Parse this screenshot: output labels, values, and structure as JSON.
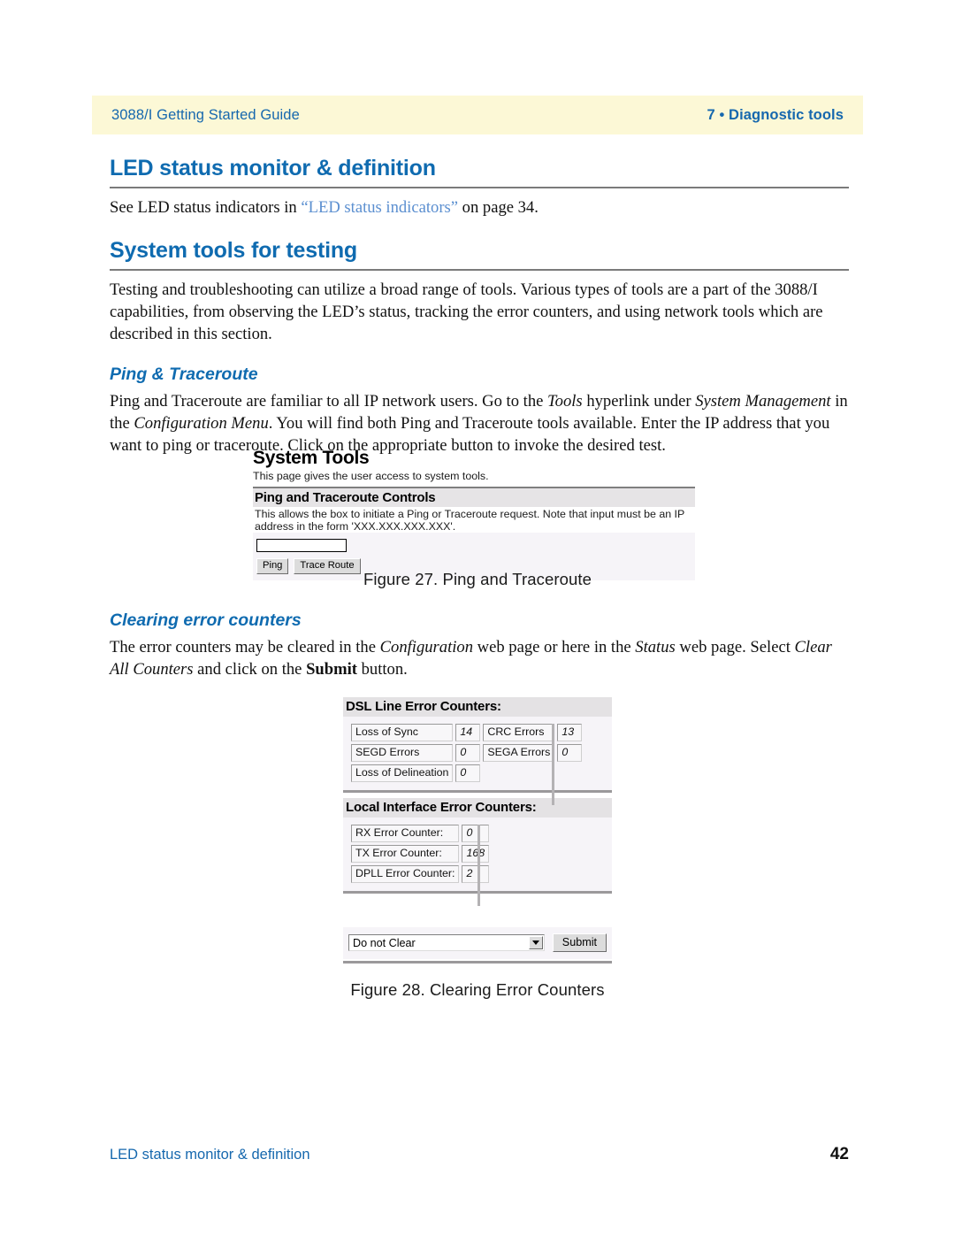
{
  "header": {
    "left": "3088/I Getting Started Guide",
    "right": "7 • Diagnostic tools"
  },
  "sections": {
    "led": {
      "title": "LED status monitor & definition",
      "body_before": "See LED status indicators in ",
      "link": "“LED status indicators”",
      "body_after": " on page 34."
    },
    "system_tools": {
      "title": "System tools for testing",
      "paragraph": "Testing and troubleshooting can utilize a broad range of tools. Various types of tools are a part of the 3088/I capabilities, from observing the LED’s status, tracking the error counters, and using network tools which are described in this section."
    },
    "ping": {
      "title": "Ping & Traceroute",
      "p1": "Ping and Traceroute are familiar to all IP network users. Go to the ",
      "i1": "Tools",
      "p2": " hyperlink under ",
      "i2": "System Management",
      "p3": " in the ",
      "i3": "Configuration Menu",
      "p4": ". You will find both Ping and Traceroute tools available. Enter the IP address that you want to ping or traceroute. Click on the appropriate button to invoke the desired test."
    },
    "clearing": {
      "title": "Clearing error counters",
      "p1": "The error counters may be cleared in the ",
      "i1": "Configuration",
      "p2": " web page or here in the ",
      "i2": "Status",
      "p3": " web page. Select ",
      "i3": "Clear All Counters",
      "p4": " and click on the ",
      "b1": "Submit",
      "p5": " button."
    }
  },
  "figure27": {
    "caption": "Figure 27. Ping and Traceroute",
    "screenshot": {
      "title": "System Tools",
      "subtitle": "This page gives the user access to system tools.",
      "section_band": "Ping and Traceroute Controls",
      "description": "This allows the box to initiate a Ping or Traceroute request. Note that input must be an IP address in the form 'XXX.XXX.XXX.XXX'.",
      "ip_input_value": "",
      "ip_input_placeholder": "",
      "ping_button": "Ping",
      "traceroute_button": "Trace Route"
    }
  },
  "figure28": {
    "caption": "Figure 28. Clearing Error Counters",
    "screenshot": {
      "dsl_band": "DSL Line Error Counters:",
      "dsl_rows": [
        {
          "label_a": "Loss of Sync",
          "value_a": "14",
          "label_b": "CRC Errors",
          "value_b": "13"
        },
        {
          "label_a": "SEGD Errors",
          "value_a": "0",
          "label_b": "SEGA Errors",
          "value_b": "0"
        },
        {
          "label_a": "Loss of Delineation",
          "value_a": "0",
          "label_b": "",
          "value_b": ""
        }
      ],
      "local_band": "Local Interface Error Counters:",
      "local_rows": [
        {
          "label": "RX Error Counter:",
          "value": "0"
        },
        {
          "label": "TX Error Counter:",
          "value": "168"
        },
        {
          "label": "DPLL Error Counter:",
          "value": "2"
        }
      ],
      "clear_select_value": "Do not Clear",
      "submit_button": "Submit"
    }
  },
  "footer": {
    "left": "LED status monitor & definition",
    "page": "42"
  },
  "colors": {
    "heading_blue": "#0f6bb0",
    "header_band": "#fcf8d6",
    "xref_blue": "#5b8fd0",
    "rule_gray": "#7b7b7b"
  }
}
